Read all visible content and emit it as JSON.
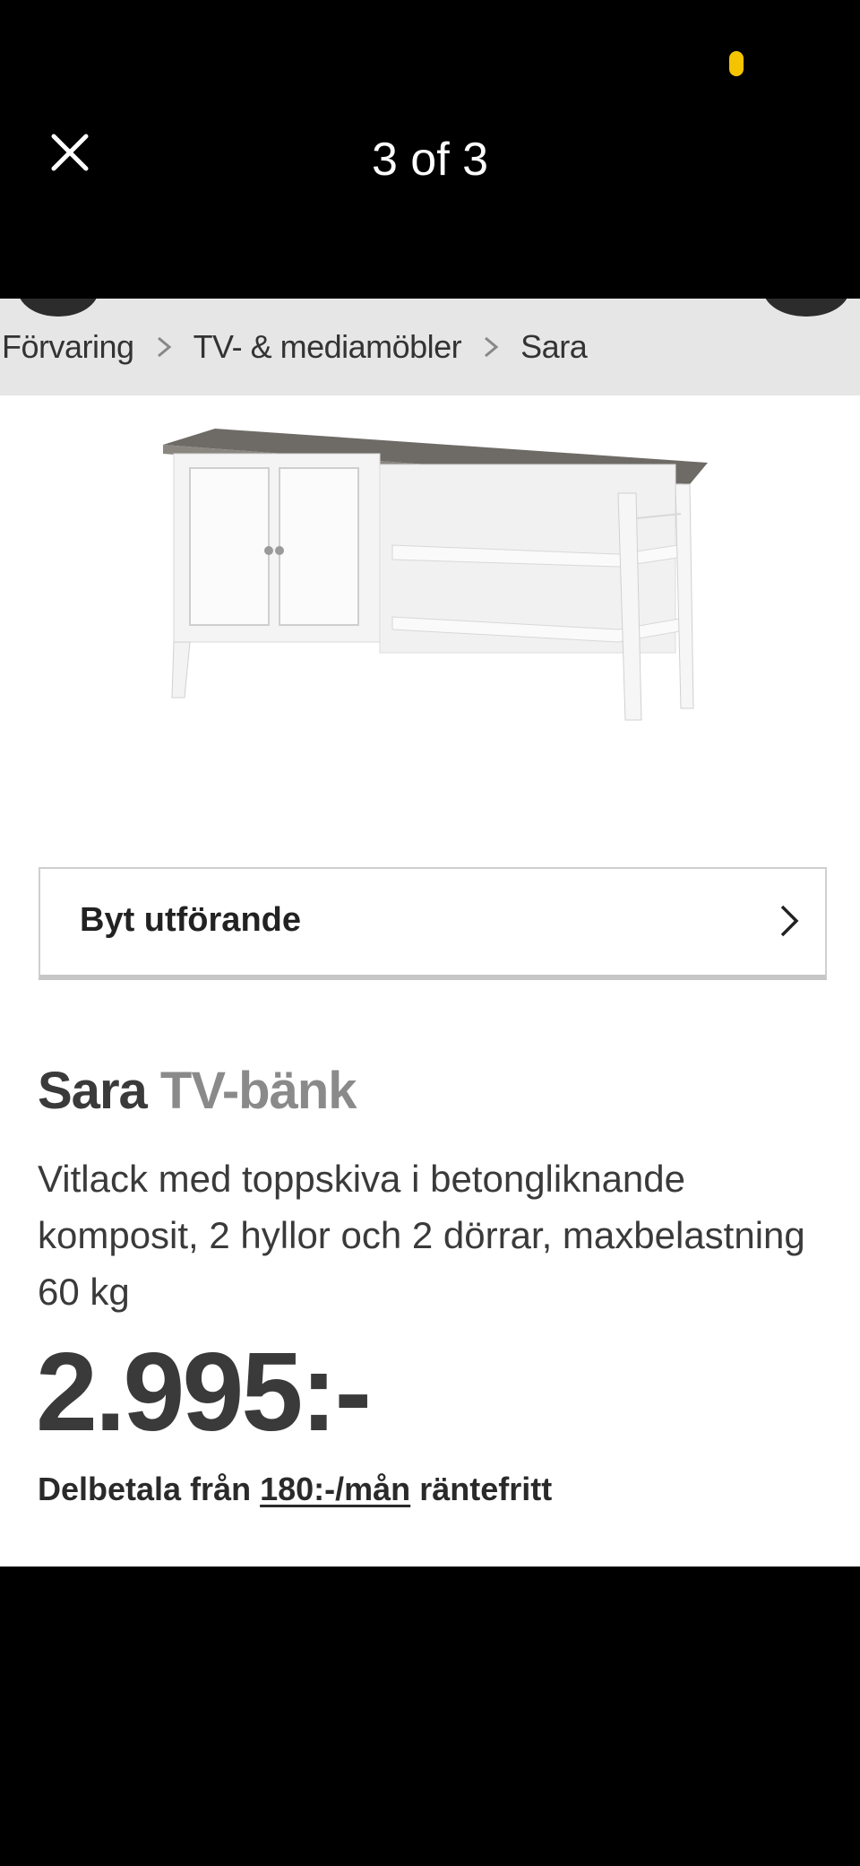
{
  "viewer": {
    "counter_text": "3 of 3",
    "close_icon": "close-icon"
  },
  "breadcrumb": {
    "items": [
      "Förvaring",
      "TV- & mediamöbler",
      "Sara"
    ],
    "separator_icon": "chevron-right-icon"
  },
  "product": {
    "image_icon": "tv-bench-image",
    "variant_button_label": "Byt utförande",
    "name": "Sara",
    "type": "TV-bänk",
    "description": "Vitlack med toppskiva i betongliknande komposit, 2 hyllor och 2 dörrar, maxbelastning 60 kg",
    "price": "2.995:-",
    "installment_prefix": "Delbetala från",
    "installment_amount": "180:-/mån",
    "installment_suffix": "räntefritt"
  },
  "colors": {
    "background": "#000000",
    "page": "#ffffff",
    "breadcrumb_bar": "#e6e6e6",
    "status_accent": "#f5c400"
  }
}
